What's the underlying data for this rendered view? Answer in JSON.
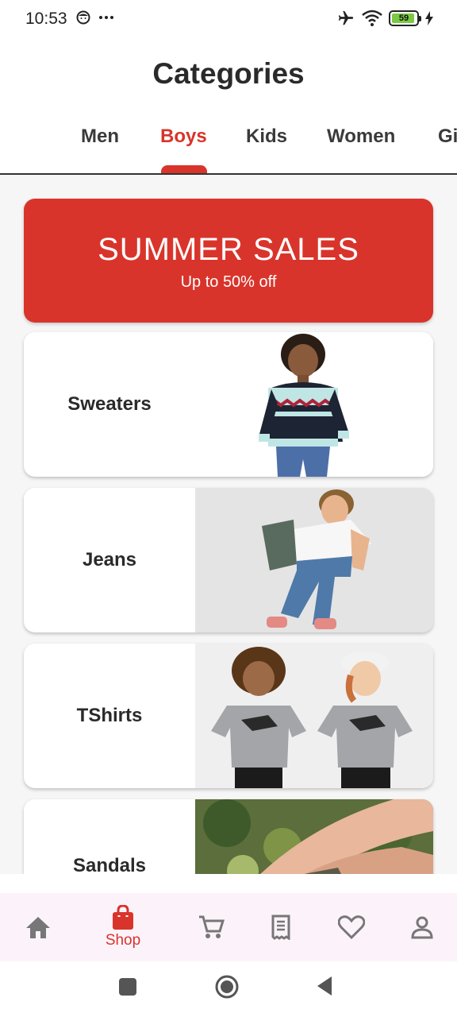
{
  "status_bar": {
    "time": "10:53",
    "battery_level": "59"
  },
  "page": {
    "title": "Categories"
  },
  "tabs": [
    {
      "label": "Men",
      "active": false
    },
    {
      "label": "Boys",
      "active": true
    },
    {
      "label": "Kids",
      "active": false
    },
    {
      "label": "Women",
      "active": false
    },
    {
      "label": "Gi",
      "active": false
    }
  ],
  "banner": {
    "title": "SUMMER SALES",
    "subtitle": "Up to 50% off"
  },
  "categories": [
    {
      "label": "Sweaters",
      "image": "boy-sweater-photo"
    },
    {
      "label": "Jeans",
      "image": "boy-jeans-photo"
    },
    {
      "label": "TShirts",
      "image": "kids-tshirts-photo"
    },
    {
      "label": "Sandals",
      "image": "sandals-photo"
    }
  ],
  "bottom_nav": {
    "items": [
      {
        "icon": "home-icon",
        "label": "",
        "active": false
      },
      {
        "icon": "shopping-bag-icon",
        "label": "Shop",
        "active": true
      },
      {
        "icon": "cart-icon",
        "label": "",
        "active": false
      },
      {
        "icon": "receipt-icon",
        "label": "",
        "active": false
      },
      {
        "icon": "heart-icon",
        "label": "",
        "active": false
      },
      {
        "icon": "profile-icon",
        "label": "",
        "active": false
      }
    ]
  },
  "colors": {
    "accent": "#d9342b",
    "nav_background": "#fcf3fa",
    "content_background": "#f6f6f6"
  }
}
